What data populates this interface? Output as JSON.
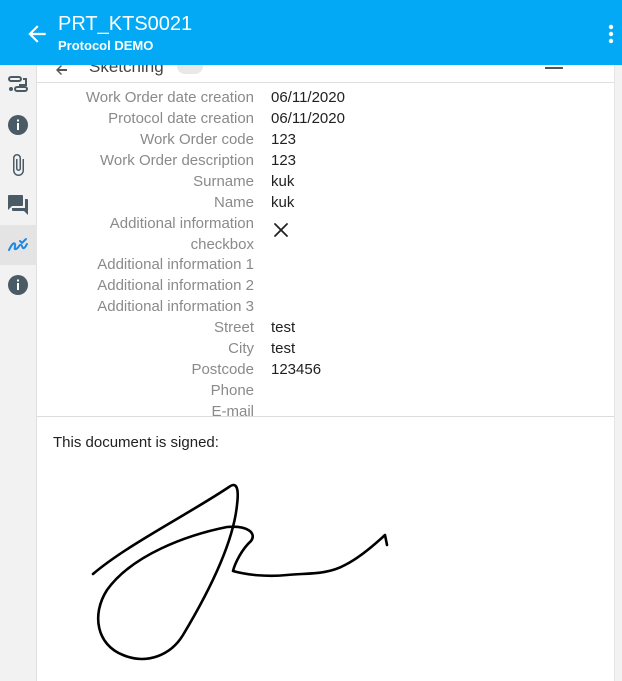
{
  "header": {
    "title": "PRT_KTS0021",
    "subtitle": "Protocol DEMO"
  },
  "sidebar": {
    "items": [
      {
        "icon": "steps-icon"
      },
      {
        "icon": "info-icon"
      },
      {
        "icon": "paperclip-icon"
      },
      {
        "icon": "chat-icon"
      },
      {
        "icon": "signature-icon",
        "active": true
      },
      {
        "icon": "info-icon"
      }
    ]
  },
  "section": {
    "title": "Sketching"
  },
  "fields": [
    {
      "label": "Work Order date creation",
      "value": "06/11/2020"
    },
    {
      "label": "Protocol date creation",
      "value": "06/11/2020"
    },
    {
      "label": "Work Order code",
      "value": "123"
    },
    {
      "label": "Work Order description",
      "value": "123"
    },
    {
      "label": "Surname",
      "value": "kuk"
    },
    {
      "label": "Name",
      "value": "kuk"
    },
    {
      "label_line1": "Additional information",
      "label_line2": "checkbox",
      "checked": false
    },
    {
      "label": "Additional information 1",
      "value": ""
    },
    {
      "label": "Additional information 2",
      "value": ""
    },
    {
      "label": "Additional information 3",
      "value": ""
    },
    {
      "label": "Street",
      "value": "test"
    },
    {
      "label": "City",
      "value": "test"
    },
    {
      "label": "Postcode",
      "value": "123456"
    },
    {
      "label": "Phone",
      "value": ""
    },
    {
      "label": "E-mail",
      "value": ""
    }
  ],
  "signature": {
    "text": "This document is signed:"
  },
  "colors": {
    "header": "#03a9f4",
    "sidebar_icon": "#4a5b66",
    "label": "#8a8a8a"
  }
}
